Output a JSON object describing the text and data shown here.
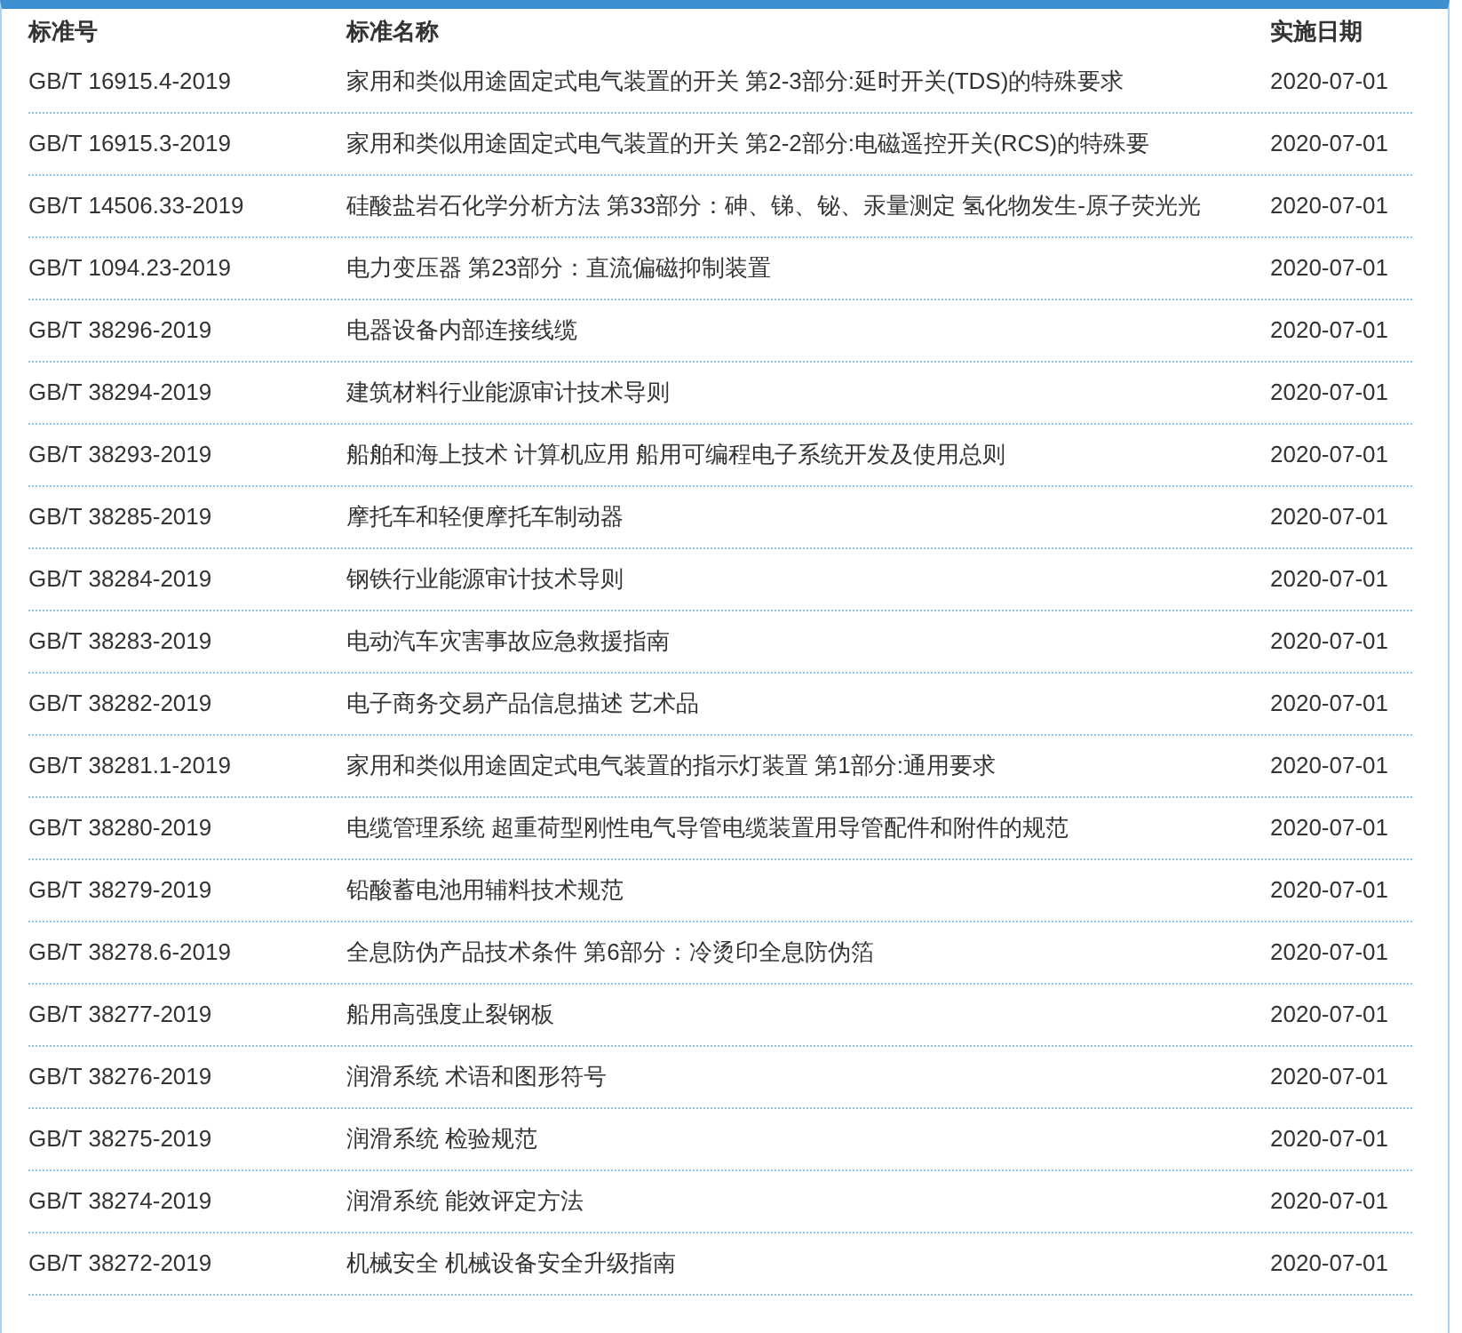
{
  "table": {
    "columns": [
      "标准号",
      "标准名称",
      "实施日期"
    ],
    "rows": [
      {
        "code": "GB/T 16915.4-2019",
        "name": "家用和类似用途固定式电气装置的开关 第2-3部分:延时开关(TDS)的特殊要求",
        "date": "2020-07-01"
      },
      {
        "code": "GB/T 16915.3-2019",
        "name": "家用和类似用途固定式电气装置的开关 第2-2部分:电磁遥控开关(RCS)的特殊要",
        "date": "2020-07-01"
      },
      {
        "code": "GB/T 14506.33-2019",
        "name": "硅酸盐岩石化学分析方法 第33部分：砷、锑、铋、汞量测定 氢化物发生-原子荧光光",
        "date": "2020-07-01"
      },
      {
        "code": "GB/T 1094.23-2019",
        "name": "电力变压器 第23部分：直流偏磁抑制装置",
        "date": "2020-07-01"
      },
      {
        "code": "GB/T 38296-2019",
        "name": "电器设备内部连接线缆",
        "date": "2020-07-01"
      },
      {
        "code": "GB/T 38294-2019",
        "name": "建筑材料行业能源审计技术导则",
        "date": "2020-07-01"
      },
      {
        "code": "GB/T 38293-2019",
        "name": "船舶和海上技术 计算机应用 船用可编程电子系统开发及使用总则",
        "date": "2020-07-01"
      },
      {
        "code": "GB/T 38285-2019",
        "name": "摩托车和轻便摩托车制动器",
        "date": "2020-07-01"
      },
      {
        "code": "GB/T 38284-2019",
        "name": "钢铁行业能源审计技术导则",
        "date": "2020-07-01"
      },
      {
        "code": "GB/T 38283-2019",
        "name": "电动汽车灾害事故应急救援指南",
        "date": "2020-07-01"
      },
      {
        "code": "GB/T 38282-2019",
        "name": "电子商务交易产品信息描述 艺术品",
        "date": "2020-07-01"
      },
      {
        "code": "GB/T 38281.1-2019",
        "name": "家用和类似用途固定式电气装置的指示灯装置 第1部分:通用要求",
        "date": "2020-07-01"
      },
      {
        "code": "GB/T 38280-2019",
        "name": "电缆管理系统 超重荷型刚性电气导管电缆装置用导管配件和附件的规范",
        "date": "2020-07-01"
      },
      {
        "code": "GB/T 38279-2019",
        "name": "铅酸蓄电池用辅料技术规范",
        "date": "2020-07-01"
      },
      {
        "code": "GB/T 38278.6-2019",
        "name": "全息防伪产品技术条件 第6部分：冷烫印全息防伪箔",
        "date": "2020-07-01"
      },
      {
        "code": "GB/T 38277-2019",
        "name": "船用高强度止裂钢板",
        "date": "2020-07-01"
      },
      {
        "code": "GB/T 38276-2019",
        "name": "润滑系统 术语和图形符号",
        "date": "2020-07-01"
      },
      {
        "code": "GB/T 38275-2019",
        "name": "润滑系统 检验规范",
        "date": "2020-07-01"
      },
      {
        "code": "GB/T 38274-2019",
        "name": "润滑系统 能效评定方法",
        "date": "2020-07-01"
      },
      {
        "code": "GB/T 38272-2019",
        "name": "机械安全 机械设备安全升级指南",
        "date": "2020-07-01"
      }
    ]
  }
}
